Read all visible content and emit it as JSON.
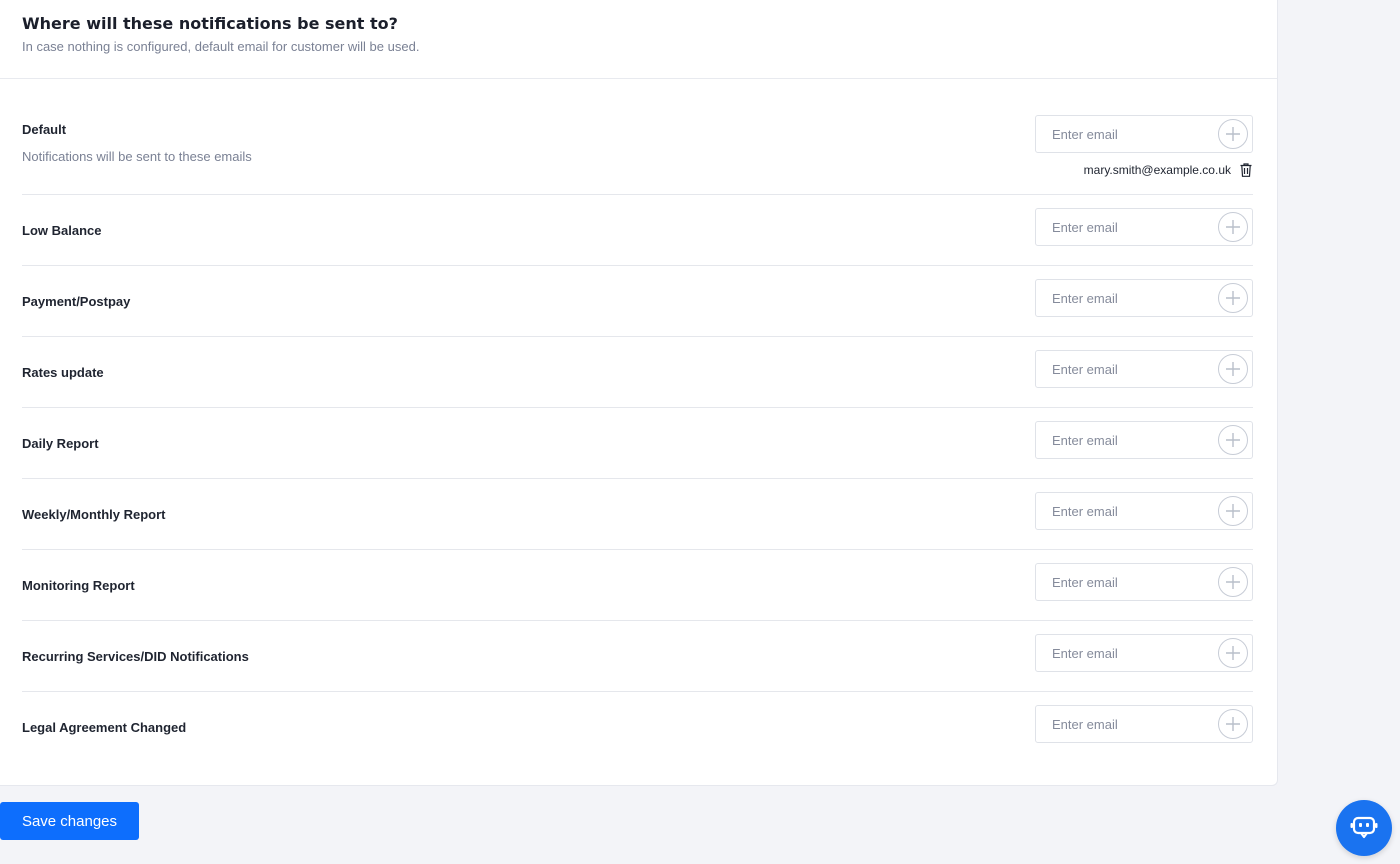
{
  "header": {
    "title": "Where will these notifications be sent to?",
    "subtitle": "In case nothing is configured, default email for customer will be used."
  },
  "email_placeholder": "Enter email",
  "default_row": {
    "label": "Default",
    "description": "Notifications will be sent to these emails",
    "emails": [
      "mary.smith@example.co.uk"
    ]
  },
  "rows": [
    {
      "label": "Low Balance"
    },
    {
      "label": "Payment/Postpay"
    },
    {
      "label": "Rates update"
    },
    {
      "label": "Daily Report"
    },
    {
      "label": "Weekly/Monthly Report"
    },
    {
      "label": "Monitoring Report"
    },
    {
      "label": "Recurring Services/DID Notifications"
    },
    {
      "label": "Legal Agreement Changed"
    }
  ],
  "save_label": "Save changes",
  "colors": {
    "primary": "#0d6efd",
    "chat_button": "#1a73f0",
    "background": "#f3f4f8"
  },
  "icons": {
    "add": "plus-circle-icon",
    "delete": "trash-icon",
    "chat": "chatbot-icon"
  }
}
